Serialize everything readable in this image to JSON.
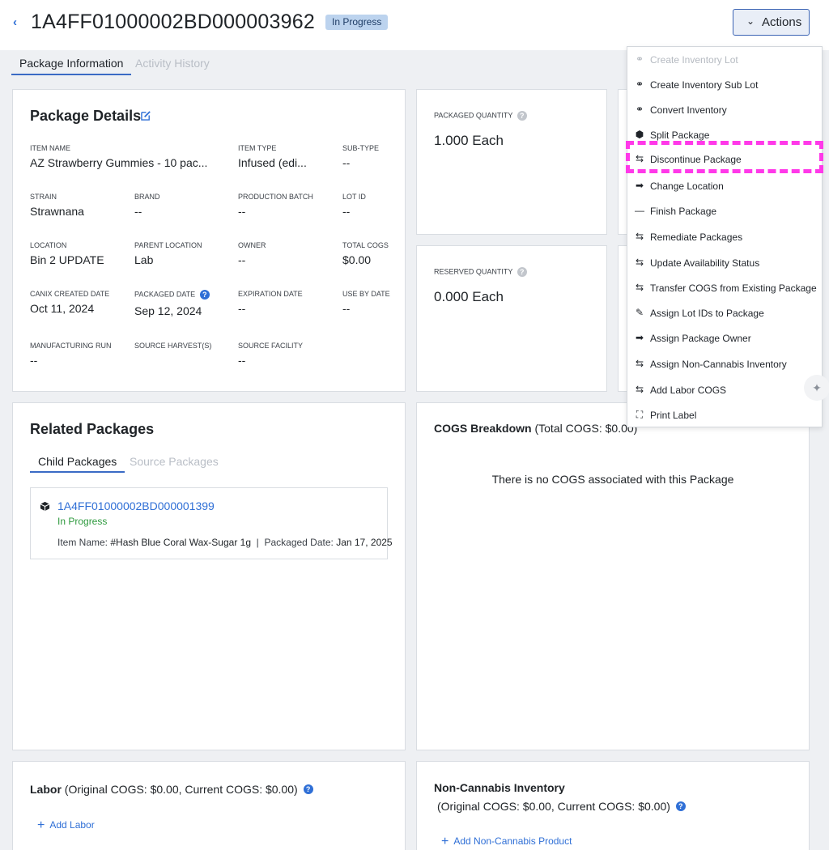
{
  "header": {
    "back_icon": "chevron-left-icon",
    "package_id": "1A4FF01000002BD000003962",
    "status": "In Progress",
    "actions_label": "Actions"
  },
  "tabs": [
    {
      "label": "Package Information",
      "active": true
    },
    {
      "label": "Activity History",
      "active": false
    }
  ],
  "details": {
    "title": "Package Details",
    "fields": [
      {
        "label": "ITEM NAME",
        "value": "AZ Strawberry Gummies - 10 pac..."
      },
      {
        "label": "ITEM TYPE",
        "value": "Infused (edi..."
      },
      {
        "label": "SUB-TYPE",
        "value": "--"
      },
      {
        "label": "STRAIN",
        "value": "Strawnana"
      },
      {
        "label": "BRAND",
        "value": "--"
      },
      {
        "label": "PRODUCTION BATCH",
        "value": "--"
      },
      {
        "label": "LOT ID",
        "value": "--"
      },
      {
        "label": "LOCATION",
        "value": "Bin 2 UPDATE"
      },
      {
        "label": "PARENT LOCATION",
        "value": "Lab"
      },
      {
        "label": "OWNER",
        "value": "--"
      },
      {
        "label": "TOTAL COGS",
        "value": "$0.00"
      },
      {
        "label": "CANIX CREATED DATE",
        "value": "Oct 11, 2024"
      },
      {
        "label": "PACKAGED DATE",
        "value": "Sep 12, 2024"
      },
      {
        "label": "EXPIRATION DATE",
        "value": "--"
      },
      {
        "label": "USE BY DATE",
        "value": "--"
      },
      {
        "label": "MANUFACTURING RUN",
        "value": "--"
      },
      {
        "label": "SOURCE HARVEST(S)",
        "value": ""
      },
      {
        "label": "SOURCE FACILITY",
        "value": "--"
      }
    ]
  },
  "quantities": {
    "packaged_label": "PACKAGED QUANTITY",
    "packaged_value": "1.000 Each",
    "reserved_label": "RESERVED QUANTITY",
    "reserved_value": "0.000 Each"
  },
  "related": {
    "title": "Related Packages",
    "tabs": [
      {
        "label": "Child Packages",
        "active": true
      },
      {
        "label": "Source Packages",
        "active": false
      }
    ],
    "child": {
      "id": "1A4FF01000002BD000001399",
      "status": "In Progress",
      "item_name_label": "Item Name:",
      "item_name": "#Hash Blue Coral Wax-Sugar 1g",
      "separator": "|",
      "packaged_date_label": "Packaged Date:",
      "packaged_date": "Jan 17, 2025"
    }
  },
  "cogs": {
    "title": "COGS Breakdown",
    "total": "(Total COGS: $0.00)",
    "empty": "There is no COGS associated with this Package"
  },
  "labor": {
    "title": "Labor",
    "subtitle": "(Original COGS: $0.00, Current COGS: $0.00)",
    "add_label": "Add Labor"
  },
  "non_cannabis": {
    "title": "Non-Cannabis Inventory",
    "subtitle": "(Original COGS: $0.00, Current COGS: $0.00)",
    "add_label": "Add Non-Cannabis Product"
  },
  "actions_menu": [
    {
      "label": "Create Inventory Lot",
      "icon": "lot-icon",
      "disabled": true
    },
    {
      "label": "Create Inventory Sub Lot",
      "icon": "lot-icon",
      "disabled": false
    },
    {
      "label": "Convert Inventory",
      "icon": "convert-icon",
      "disabled": false
    },
    {
      "label": "Split Package",
      "icon": "cube-icon",
      "disabled": false
    },
    {
      "label": "Discontinue Package",
      "icon": "swap-arrows-icon",
      "disabled": false
    },
    {
      "label": "Change Location",
      "icon": "arrow-right-icon",
      "disabled": false
    },
    {
      "label": "Finish Package",
      "icon": "minus-icon",
      "disabled": false
    },
    {
      "label": "Remediate Packages",
      "icon": "swap-arrows-icon",
      "disabled": false
    },
    {
      "label": "Update Availability Status",
      "icon": "swap-arrows-icon",
      "disabled": false
    },
    {
      "label": "Transfer COGS from Existing Package",
      "icon": "swap-arrows-icon",
      "disabled": false
    },
    {
      "label": "Assign Lot IDs to Package",
      "icon": "edit-icon",
      "disabled": false
    },
    {
      "label": "Assign Package Owner",
      "icon": "arrow-right-icon",
      "disabled": false
    },
    {
      "label": "Assign Non-Cannabis Inventory",
      "icon": "swap-arrows-icon",
      "disabled": false
    },
    {
      "label": "Add Labor COGS",
      "icon": "swap-arrows-icon",
      "disabled": false
    },
    {
      "label": "Print Label",
      "icon": "label-frame-icon",
      "disabled": false
    }
  ],
  "colors": {
    "accent": "#2f6fd6",
    "status_pill": "#bcd3ee",
    "success": "#2e9a3e",
    "highlight": "#ff39e9"
  }
}
